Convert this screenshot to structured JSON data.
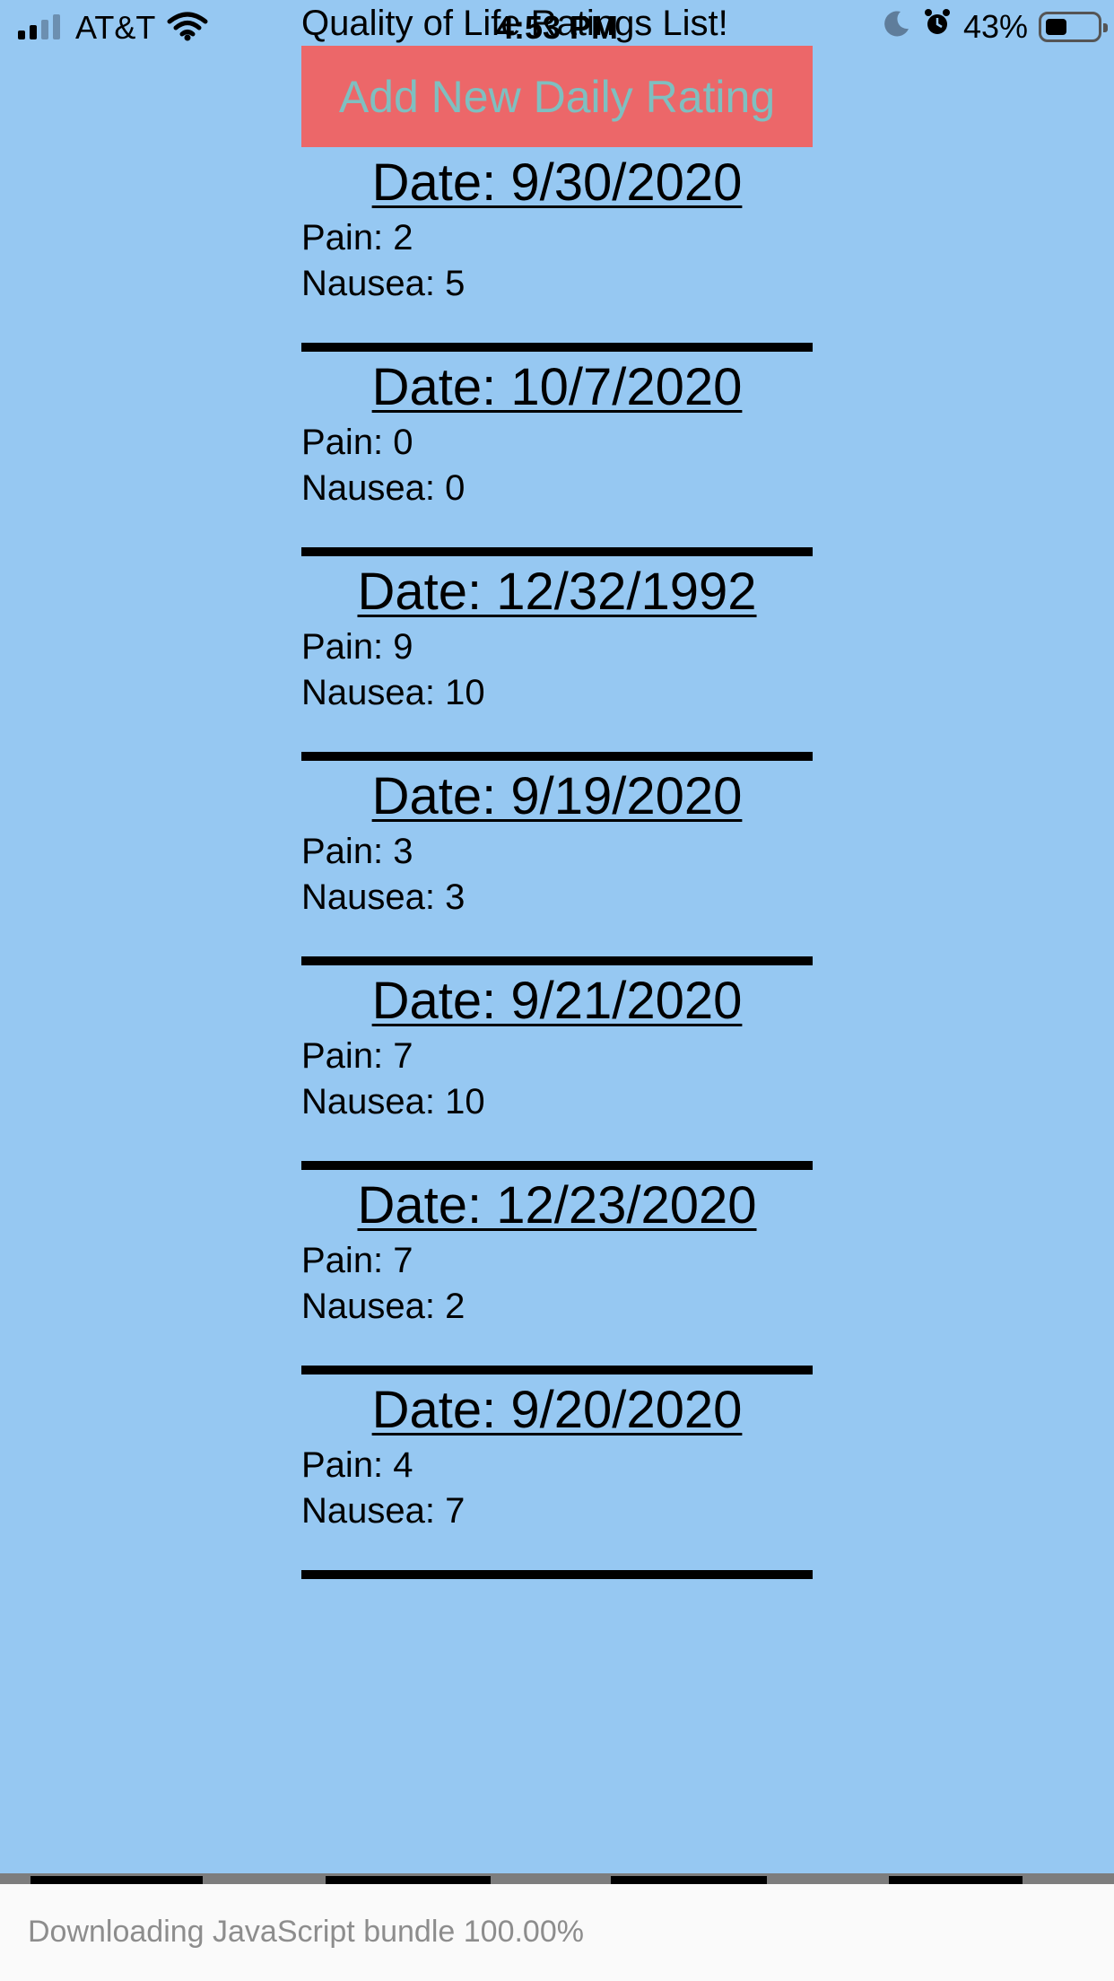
{
  "status_bar": {
    "carrier": "AT&T",
    "time": "4:53 PM",
    "battery_percent": "43%",
    "battery_level": 0.43,
    "icons": [
      "signal-icon",
      "wifi-icon",
      "moon-icon",
      "alarm-icon",
      "battery-icon"
    ]
  },
  "app": {
    "title": "Quality of Life Ratings List!",
    "add_button_label": "Add New Daily Rating"
  },
  "ratings": [
    {
      "date": "Date: 9/30/2020",
      "pain": "Pain: 2",
      "nausea": "Nausea: 5"
    },
    {
      "date": "Date: 10/7/2020",
      "pain": "Pain: 0",
      "nausea": "Nausea: 0"
    },
    {
      "date": "Date: 12/32/1992",
      "pain": "Pain: 9",
      "nausea": "Nausea: 10"
    },
    {
      "date": "Date: 9/19/2020",
      "pain": "Pain: 3",
      "nausea": "Nausea: 3"
    },
    {
      "date": "Date: 9/21/2020",
      "pain": "Pain: 7",
      "nausea": "Nausea: 10"
    },
    {
      "date": "Date: 12/23/2020",
      "pain": "Pain: 7",
      "nausea": "Nausea: 2"
    },
    {
      "date": "Date: 9/20/2020",
      "pain": "Pain: 4",
      "nausea": "Nausea: 7"
    }
  ],
  "loading": {
    "text": "Downloading JavaScript bundle 100.00%",
    "progress": 1.0
  },
  "colors": {
    "background": "#96c8f2",
    "button_bg": "#ec6769",
    "button_text": "#7fbfc0",
    "divider": "#000000",
    "loading_panel": "#fafafa",
    "loading_text": "#8d8d8d"
  }
}
